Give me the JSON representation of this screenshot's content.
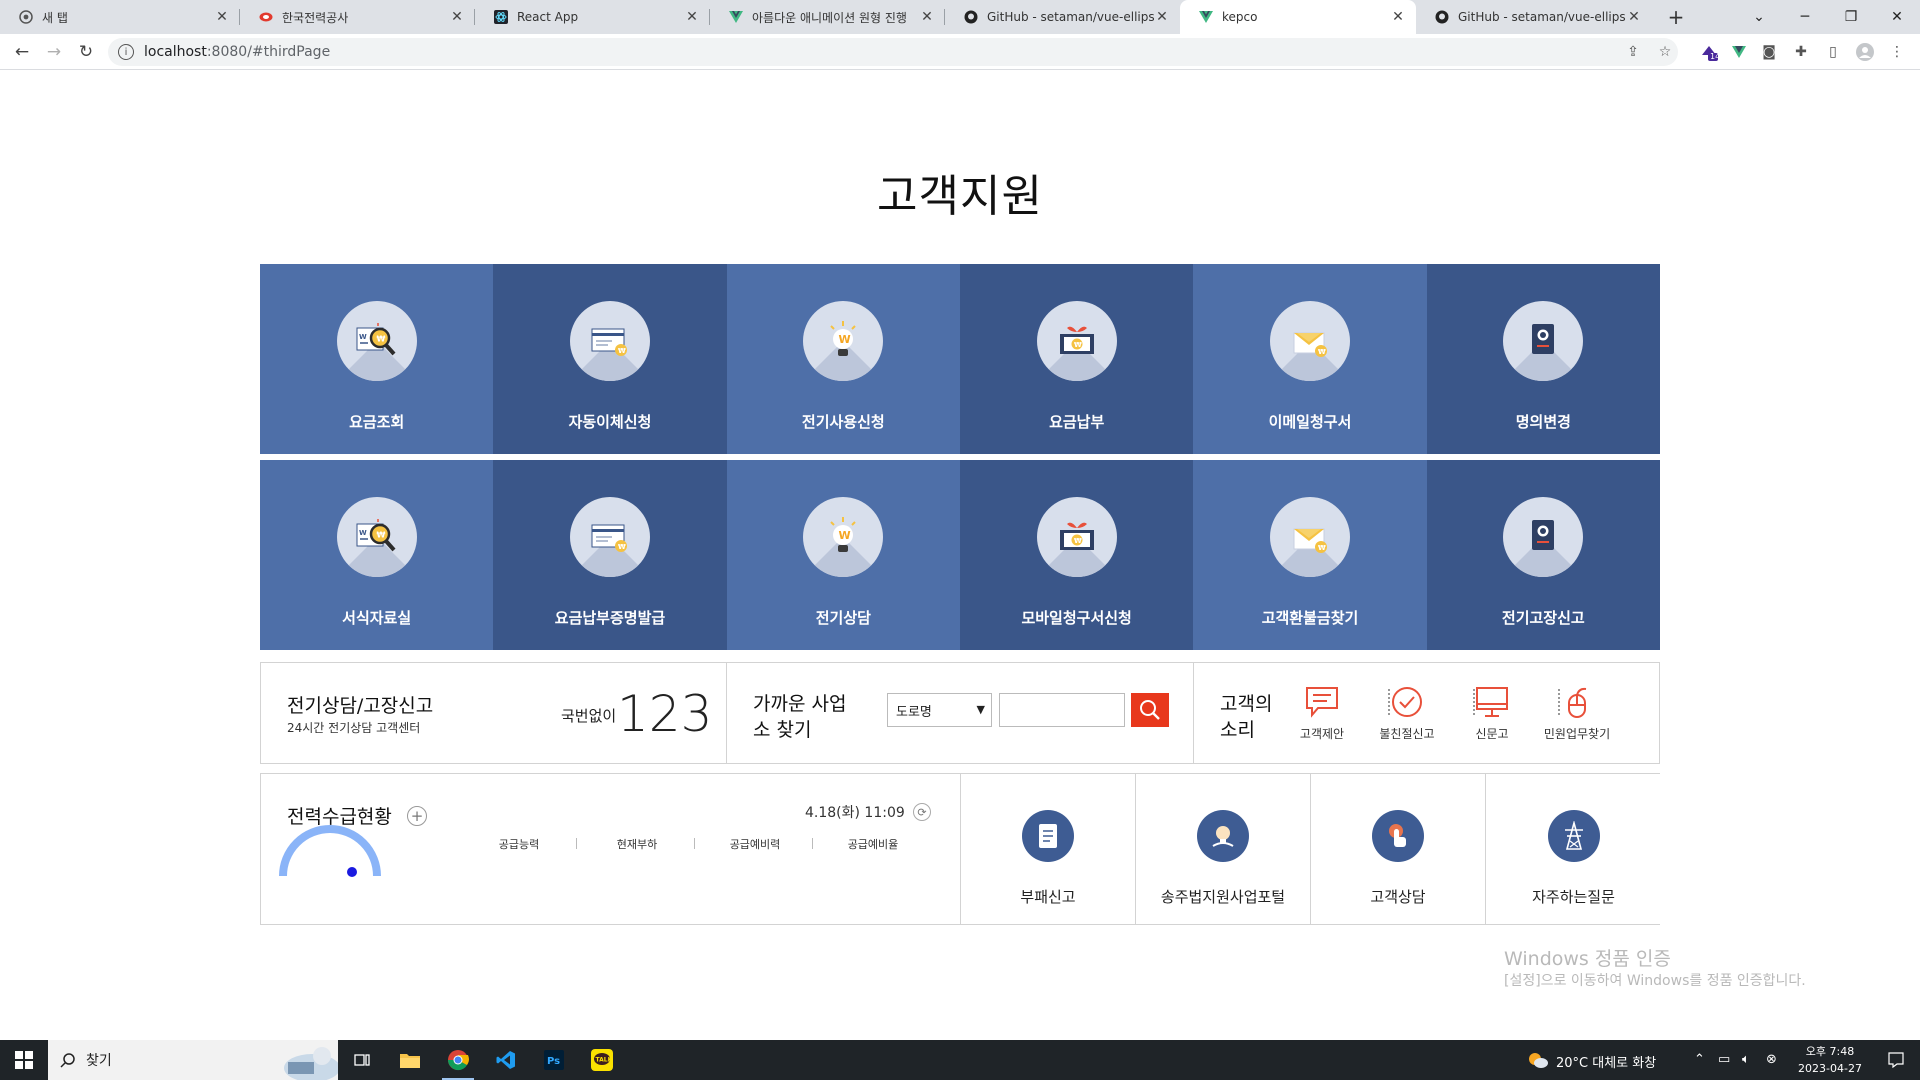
{
  "browser": {
    "tabs": [
      {
        "title": "새 탭",
        "icon": "chrome-icon",
        "active": false
      },
      {
        "title": "한국전력공사",
        "icon": "kepco-logo-icon",
        "active": false
      },
      {
        "title": "React App",
        "icon": "react-icon",
        "active": false
      },
      {
        "title": "아름다운 애니메이션 원형 진행",
        "icon": "vue-icon",
        "active": false
      },
      {
        "title": "GitHub - setaman/vue-ellipse-p",
        "icon": "github-icon",
        "active": false
      },
      {
        "title": "kepco",
        "icon": "vue-icon",
        "active": true
      },
      {
        "title": "GitHub - setaman/vue-ellipse-p",
        "icon": "github-icon",
        "active": false
      }
    ],
    "url_host": "localhost",
    "url_path": ":8080/#thirdPage",
    "extension_badge": "14"
  },
  "page": {
    "title": "고객지원",
    "tiles": [
      {
        "label": "요금조회",
        "icon": "bill-search-icon",
        "shade": "light"
      },
      {
        "label": "자동이체신청",
        "icon": "card-transfer-icon",
        "shade": "dark"
      },
      {
        "label": "전기사용신청",
        "icon": "lightbulb-icon",
        "shade": "light"
      },
      {
        "label": "요금납부",
        "icon": "money-plant-icon",
        "shade": "dark"
      },
      {
        "label": "이메일청구서",
        "icon": "email-bill-icon",
        "shade": "light"
      },
      {
        "label": "명의변경",
        "icon": "passport-icon",
        "shade": "dark"
      },
      {
        "label": "서식자료실",
        "icon": "bill-search-icon",
        "shade": "light"
      },
      {
        "label": "요금납부증명발급",
        "icon": "card-transfer-icon",
        "shade": "dark"
      },
      {
        "label": "전기상담",
        "icon": "lightbulb-icon",
        "shade": "light"
      },
      {
        "label": "모바일청구서신청",
        "icon": "money-plant-icon",
        "shade": "dark"
      },
      {
        "label": "고객환불금찾기",
        "icon": "email-bill-icon",
        "shade": "light"
      },
      {
        "label": "전기고장신고",
        "icon": "passport-icon",
        "shade": "dark"
      }
    ],
    "tile_colors": {
      "light": "#4e6fa8",
      "dark": "#3a5689"
    },
    "consult": {
      "title": "전기상담/고장신고",
      "subtitle": "24시간 전기상담 고객센터",
      "prefix": "국번없이",
      "number": "123"
    },
    "nearby": {
      "title": "가까운 사업소 찾기",
      "select_value": "도로명",
      "search_value": ""
    },
    "voice": {
      "title": "고객의 소리",
      "items": [
        {
          "label": "고객제안",
          "icon": "speech-bubble-icon"
        },
        {
          "label": "불친절신고",
          "icon": "check-circle-icon"
        },
        {
          "label": "신문고",
          "icon": "monitor-icon"
        },
        {
          "label": "민원업무찾기",
          "icon": "mouse-icon"
        }
      ]
    },
    "power": {
      "title": "전력수급현황",
      "datetime": "4.18(화) 11:09",
      "columns": [
        "공급능력",
        "현재부하",
        "공급예비력",
        "공급예비율"
      ]
    },
    "quick_links": [
      {
        "label": "부패신고",
        "icon": "document-icon"
      },
      {
        "label": "송주법지원사업포털",
        "icon": "bulb-hand-icon"
      },
      {
        "label": "고객상담",
        "icon": "touch-hand-icon"
      },
      {
        "label": "자주하는질문",
        "icon": "transmission-tower-icon"
      }
    ],
    "accent_color": "#e8381c"
  },
  "watermark": {
    "line1": "Windows 정품 인증",
    "line2": "[설정]으로 이동하여 Windows를 정품 인증합니다."
  },
  "taskbar": {
    "search_placeholder": "찾기",
    "weather": "20°C  대체로 화창",
    "time": "오후 7:48",
    "date": "2023-04-27"
  }
}
